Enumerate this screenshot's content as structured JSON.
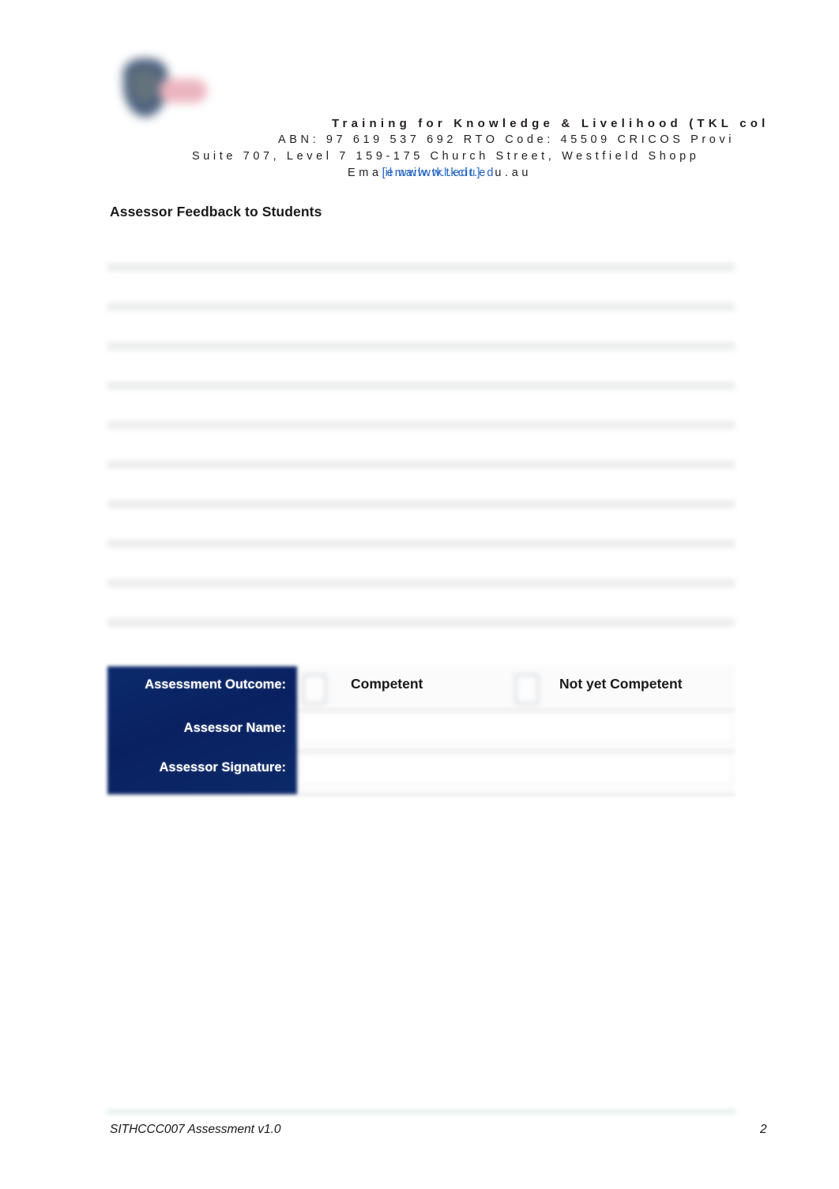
{
  "document": {
    "page_number": "2",
    "footer_text": "SITHCCC007 Assessment v1.0"
  },
  "header": {
    "logo_name": "tkl-college-logo",
    "line1": "Training for Knowledge & Livelihood (TKL col",
    "line2": "ABN: 97 619 537 692 RTO Code: 45509 CRICOS Provi",
    "line3": "Suite 707, Level 7 159-175 Church Street, Westfield Shopp",
    "email_prefix": "Ema",
    "email_link_front": "[email",
    "email_link_overlap": "il  www.tkl.edu]",
    "email_link_back": "ww.tkcit.ed",
    "email_suffix": "u.au"
  },
  "section": {
    "title": "Assessor Feedback to Students"
  },
  "feedback": {
    "line_count": 10,
    "lines": [
      "",
      "",
      "",
      "",
      "",
      "",
      "",
      "",
      "",
      ""
    ]
  },
  "outcome_table": {
    "rows": [
      {
        "label": "Assessment Outcome:",
        "value": ""
      },
      {
        "label": "Assessor Name:",
        "value": ""
      },
      {
        "label": "Assessor Signature:",
        "value": ""
      }
    ],
    "options": [
      {
        "label": "Competent",
        "checked": false
      },
      {
        "label": "Not yet Competent",
        "checked": false
      }
    ],
    "accent_color": "#0a2161"
  }
}
